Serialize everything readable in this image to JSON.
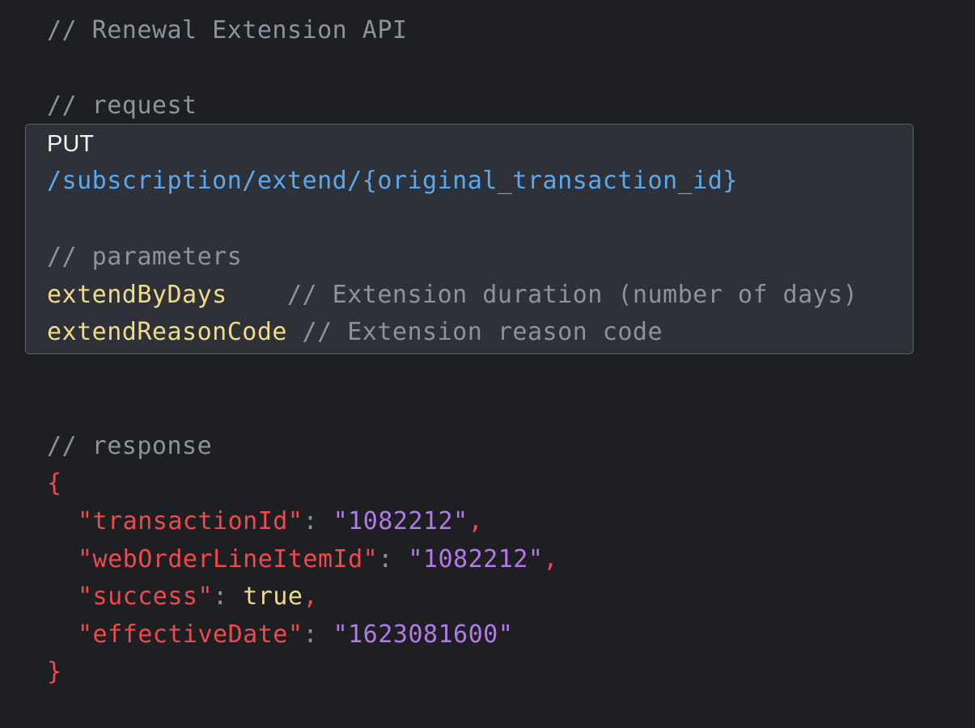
{
  "header_comment": "// Renewal Extension API",
  "request": {
    "comment": "// request",
    "method": "PUT",
    "path": "/subscription/extend/{original_transaction_id}",
    "params_comment": "// parameters",
    "params": [
      {
        "name": "extendByDays",
        "spacer": "    ",
        "comment": "// Extension duration (number of days)"
      },
      {
        "name": "extendReasonCode",
        "spacer": " ",
        "comment": "// Extension reason code"
      }
    ]
  },
  "response": {
    "comment": "// response",
    "open_brace": "{",
    "close_brace": "}",
    "fields": [
      {
        "key": "\"transactionId\"",
        "sep": ": ",
        "value": "\"1082212\"",
        "comma": ","
      },
      {
        "key": "\"webOrderLineItemId\"",
        "sep": ": ",
        "value": "\"1082212\"",
        "comma": ","
      },
      {
        "key": "\"success\"",
        "sep": ": ",
        "value": "true",
        "comma": ","
      },
      {
        "key": "\"effectiveDate\"",
        "sep": ": ",
        "value": "\"1623081600\"",
        "comma": ""
      }
    ]
  },
  "colors": {
    "background": "#1e1f22",
    "highlight_bg": "#2e3138",
    "comment": "#8b939c",
    "string": "#b17ae8",
    "key": "#ee4a4e",
    "identifier": "#efdb8a",
    "path": "#5aa8f0"
  }
}
